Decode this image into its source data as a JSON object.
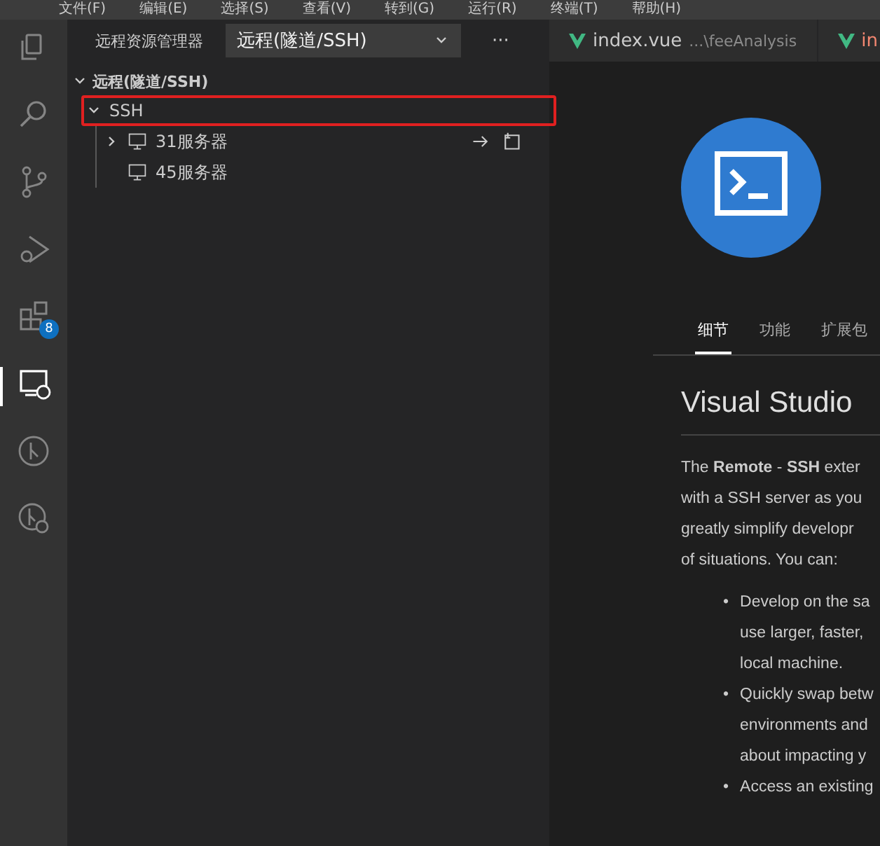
{
  "menu_bar": [
    "文件(F)",
    "编辑(E)",
    "选择(S)",
    "查看(V)",
    "转到(G)",
    "运行(R)",
    "终端(T)",
    "帮助(H)"
  ],
  "activity_bar": [
    {
      "kind": "explorer",
      "selected": false
    },
    {
      "kind": "search",
      "selected": false
    },
    {
      "kind": "source-control",
      "selected": false
    },
    {
      "kind": "run",
      "selected": false
    },
    {
      "kind": "extensions",
      "selected": false,
      "badge": "8"
    },
    {
      "kind": "remote",
      "selected": true
    },
    {
      "kind": "git-graph",
      "selected": false
    },
    {
      "kind": "git-history",
      "selected": false
    }
  ],
  "sidebar": {
    "title": "远程资源管理器",
    "dropdown": "远程(隧道/SSH)",
    "more": "···",
    "section": "远程(隧道/SSH)",
    "tree": [
      {
        "label": "SSH",
        "expanded": true,
        "highlighted": true,
        "children": [
          {
            "label": "31服务器",
            "expandable": true,
            "expanded": false,
            "hovered": true
          },
          {
            "label": "45服务器",
            "expandable": false,
            "hovered": false
          }
        ]
      }
    ]
  },
  "editor_tabs": [
    {
      "name": "index.vue",
      "path": "...\\feeAnalysis",
      "color": "#cccccc"
    },
    {
      "name": "in",
      "color": "#f48771"
    }
  ],
  "extension": {
    "tabs": [
      {
        "label": "细节",
        "selected": true
      },
      {
        "label": "功能",
        "selected": false
      },
      {
        "label": "扩展包",
        "selected": false
      }
    ],
    "heading": "Visual Studio",
    "paragraph_lines": [
      "The **Remote** - **SSH** exter",
      "with a SSH server as you",
      "greatly simplify developr",
      "of situations. You can:"
    ],
    "bullets": [
      {
        "marker": "•",
        "lines": [
          "Develop on the sa",
          "use larger, faster,",
          "local machine."
        ]
      },
      {
        "marker": "•",
        "lines": [
          "Quickly swap betw",
          "environments and",
          "about impacting y"
        ]
      },
      {
        "marker": "•",
        "lines": [
          "Access an existing"
        ]
      }
    ]
  }
}
